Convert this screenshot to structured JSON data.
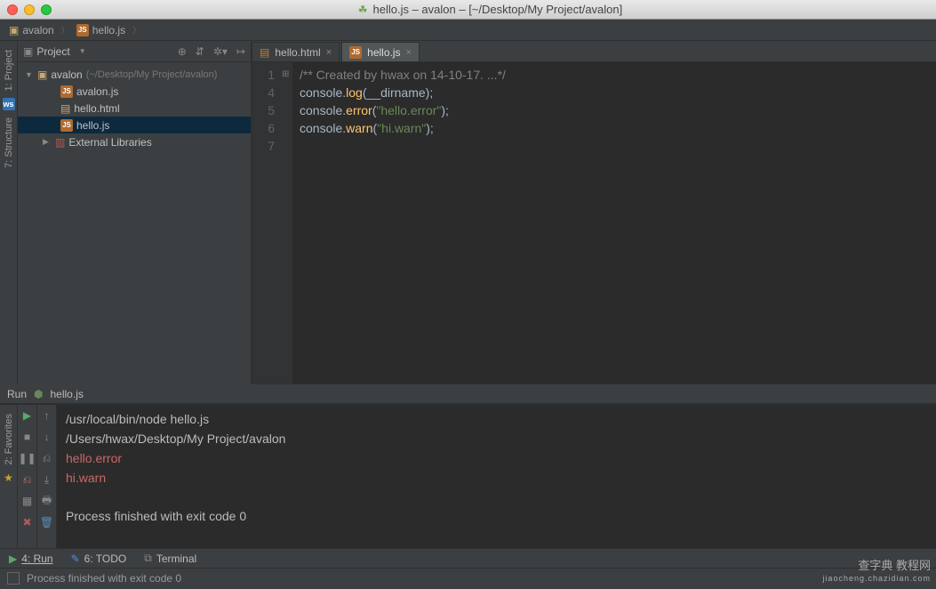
{
  "window": {
    "title": "hello.js – avalon – [~/Desktop/My Project/avalon]"
  },
  "breadcrumbs": {
    "folder": "avalon",
    "file": "hello.js"
  },
  "project_panel": {
    "title": "Project",
    "root": {
      "name": "avalon",
      "hint": "(~/Desktop/My Project/avalon)"
    },
    "files": [
      {
        "name": "avalon.js",
        "type": "js"
      },
      {
        "name": "hello.html",
        "type": "html"
      },
      {
        "name": "hello.js",
        "type": "js",
        "selected": true
      }
    ],
    "external_libs": "External Libraries"
  },
  "left_rail": {
    "project": "1: Project",
    "structure": "7: Structure",
    "favorites": "2: Favorites"
  },
  "editor_tabs": [
    {
      "name": "hello.html",
      "type": "html",
      "active": false
    },
    {
      "name": "hello.js",
      "type": "js",
      "active": true
    }
  ],
  "code": {
    "line_numbers": [
      "1",
      "4",
      "5",
      "6",
      "7"
    ],
    "line1_comment": "/** Created by hwax on 14-10-17. ...*/",
    "line4": {
      "obj": "console",
      "method": "log",
      "arg": "__dirname"
    },
    "line5": {
      "obj": "console",
      "method": "error",
      "arg": "\"hello.error\""
    },
    "line6": {
      "obj": "console",
      "method": "warn",
      "arg": "\"hi.warn\""
    }
  },
  "run": {
    "title": "Run",
    "config": "hello.js",
    "output": {
      "cmd": "/usr/local/bin/node hello.js",
      "cwd": "/Users/hwax/Desktop/My Project/avalon",
      "err1": "hello.error",
      "err2": "hi.warn",
      "finish": "Process finished with exit code 0"
    }
  },
  "bottom_bar": {
    "run": "4: Run",
    "todo": "6: TODO",
    "terminal": "Terminal"
  },
  "status_bar": {
    "text": "Process finished with exit code 0"
  },
  "watermark": {
    "line1": "查字典 教程网",
    "line2": "jiaocheng.chazidian.com"
  }
}
